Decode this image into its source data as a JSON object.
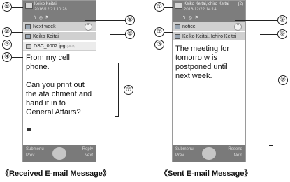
{
  "callouts": {
    "n1": "①",
    "n2": "②",
    "n3": "③",
    "n4": "④",
    "n5": "⑤",
    "n6": "⑥",
    "n7": "⑦"
  },
  "received": {
    "sender": "Keiko Keitai",
    "date": "2016/12/21 10:28",
    "icons": "↰ ◎ ⚑",
    "subject": "Next week",
    "recipient": "Keiko Keitai",
    "attachment_name": "DSC_0002.jpg",
    "attachment_size": "(9KB)",
    "body_line1": "From my cell phone.",
    "body_line2": "Can you print out the ata chment and hand it in to General Affairs?",
    "footer_left_top": "Submenu",
    "footer_left_bottom": "Prev",
    "footer_right_top": "Reply",
    "footer_right_bottom": "Next",
    "caption": "《Received E-mail Message》"
  },
  "sent": {
    "sender": "Keiko Keitai,Ichiro Keitai",
    "count": "(2)",
    "date": "2016/12/22 14:14",
    "icons": "↰ ◎ ⚑",
    "subject": "notice",
    "recipient": "Keiko Keitai, Ichiro Keitai",
    "body": "The meeting for tomorro w is postponed until next week.",
    "footer_left_top": "Submenu",
    "footer_left_bottom": "Prev",
    "footer_right_top": "Resend",
    "footer_right_bottom": "Next",
    "caption": "《Sent E-mail Message》"
  }
}
